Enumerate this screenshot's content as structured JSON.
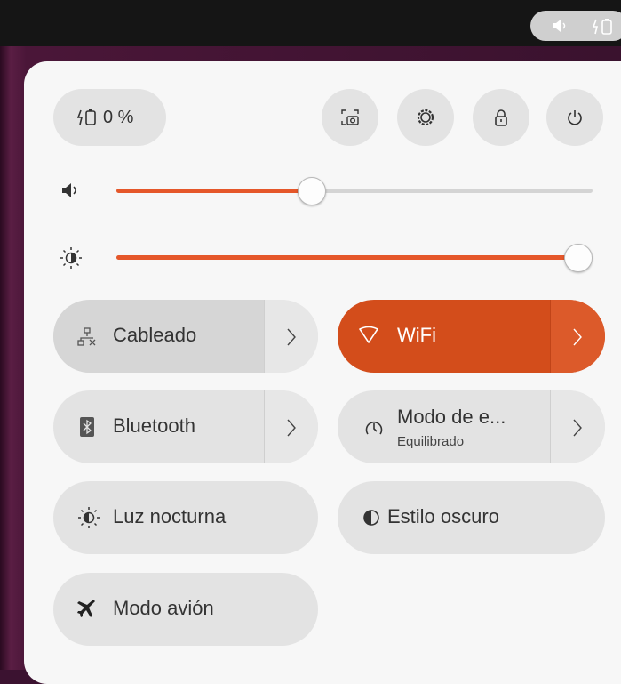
{
  "topbar": {
    "tray_icons": [
      "volume-icon",
      "battery-charging-icon"
    ]
  },
  "quick_settings": {
    "battery": {
      "label": "0 %",
      "icon": "battery-charging-icon"
    },
    "actions": [
      {
        "name": "screenshot",
        "icon": "screenshot-icon"
      },
      {
        "name": "settings",
        "icon": "gear-icon"
      },
      {
        "name": "lock",
        "icon": "lock-icon"
      },
      {
        "name": "power",
        "icon": "power-icon"
      }
    ],
    "volume": {
      "icon": "volume-icon",
      "level": 0.41
    },
    "brightness": {
      "icon": "brightness-icon",
      "level": 1.0
    },
    "tiles": {
      "wired": {
        "label": "Cableado",
        "icon": "wired-network-icon",
        "has_arrow": true,
        "active": false
      },
      "wifi": {
        "label": "WiFi",
        "icon": "wifi-icon",
        "has_arrow": true,
        "active": true
      },
      "bluetooth": {
        "label": "Bluetooth",
        "icon": "bluetooth-icon",
        "has_arrow": true,
        "active": false
      },
      "power_mode": {
        "label": "Modo de e...",
        "sublabel": "Equilibrado",
        "icon": "power-mode-icon",
        "has_arrow": true,
        "active": false
      },
      "night_light": {
        "label": "Luz nocturna",
        "icon": "night-light-icon",
        "active": false
      },
      "dark_style": {
        "label": "Estilo oscuro",
        "icon": "dark-style-icon",
        "active": false
      },
      "airplane": {
        "label": "Modo avión",
        "icon": "airplane-icon",
        "active": false
      }
    }
  },
  "colors": {
    "accent": "#D34D1B",
    "slider_fill": "#E5572A",
    "panel_bg": "#F7F7F7",
    "tile_bg": "#E3E3E3",
    "topbar_bg": "#151515"
  }
}
